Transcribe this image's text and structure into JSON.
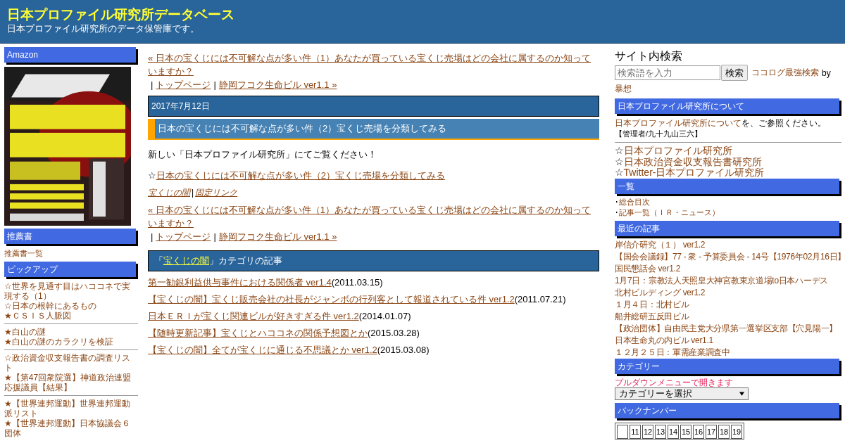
{
  "header": {
    "title": "日本プロファイル研究所データベース",
    "subtitle": "日本プロファイル研究所のデータ保管庫です。"
  },
  "left": {
    "amazon": {
      "heading": "Amazon"
    },
    "books": {
      "heading": "推薦書",
      "link": "推薦書一覧"
    },
    "pickup": {
      "heading": "ピックアップ",
      "groups": [
        [
          "☆世界を見通す目はハココネで実現する（1）",
          "☆日本の根幹にあるもの",
          "★ＣＳＩＳ人脈図"
        ],
        [
          "★白山の謎",
          "★白山の謎のカラクリを検証"
        ],
        [
          "☆政治資金収支報告書の調査リスト",
          "★【第47回衆院選】神道政治連盟応援議員【結果】"
        ],
        [
          "★【世界連邦運動】世界連邦運動派リスト",
          "★【世界連邦運動】日本協議会６団体"
        ]
      ]
    }
  },
  "main": {
    "nav_top": {
      "prev": "« 日本の宝くじには不可解な点が多い件（1）あなたが買っている宝くじ売場はどの会社に属するのか知っていますか？",
      "sep1": "|",
      "top": "トップページ",
      "sep2": "|",
      "next": "静岡フコク生命ビル ver1.1 »"
    },
    "date": "2017年7月12日",
    "post_title": "日本の宝くじには不可解な点が多い件（2）宝くじ売場を分類してみる",
    "body": "新しい「日本プロファイル研究所」にてご覧ください！",
    "body_link": {
      "prefix": "☆",
      "text": "日本の宝くじには不可解な点が多い件（2）宝くじ売場を分類してみる"
    },
    "post_footer": {
      "category": "宝くじの闇",
      "sep": "|",
      "permalink": "固定リンク"
    },
    "nav_bottom": {
      "prev": "« 日本の宝くじには不可解な点が多い件（1）あなたが買っている宝くじ売場はどの会社に属するのか知っていますか？",
      "sep1": "|",
      "top": "トップページ",
      "sep2": "|",
      "next": "静岡フコク生命ビル ver1.1 »"
    },
    "category_heading": {
      "open": "「",
      "category": "宝くじの闇",
      "close": "」カテゴリの記事"
    },
    "articles": [
      {
        "title": "第一勧銀利益供与事件における関係者 ver1.4",
        "date": "(2011.03.15)"
      },
      {
        "title": "【宝くじの闇】宝くじ販売会社の社長がジャンボの行列客として報道されている件 ver1.2",
        "date": "(2011.07.21)"
      },
      {
        "title": "日本ＥＲＩが宝くじ関連ビルが好きすぎる件 ver1.2",
        "date": "(2014.01.07)"
      },
      {
        "title": "【随時更新記事】宝くじとハココネの関係予想図とか",
        "date": "(2015.03.28)"
      },
      {
        "title": "【宝くじの闇】全てが宝くじに通じる不思議とか ver1.2",
        "date": "(2015.03.08)"
      }
    ]
  },
  "right": {
    "search": {
      "heading": "サイト内検索",
      "placeholder": "検索語を入力",
      "button": "検索",
      "credit_link": "ココログ最強検索",
      "credit_by": "by",
      "credit_author": "暴想"
    },
    "about": {
      "heading": "日本プロファイル研究所について",
      "link": "日本プロファイル研究所について",
      "text": "を、ご参照ください。",
      "admin": "【管理者/九十九山三六】",
      "sites": [
        {
          "prefix": "☆",
          "text": "日本プロファイル研究所"
        },
        {
          "prefix": "☆",
          "text": "日本政治資金収支報告書研究所"
        },
        {
          "prefix": "☆",
          "text": "Twitter-日本プロファイル研究所"
        }
      ]
    },
    "index": {
      "heading": "一覧",
      "items": [
        {
          "prefix": "･",
          "text": "総合目次"
        },
        {
          "prefix": "･",
          "text": "記事一覧（ＩＲ・ニュース）"
        }
      ]
    },
    "recent": {
      "heading": "最近の記事",
      "items": [
        "岸信介研究（１） ver1.2",
        "【国会会議録】77 - 衆 - 予算委員会 - 14号【1976年02月16日】",
        "国民懇話会 ver1.2",
        "1月7日：宗教法人天照皇大神宮教東京道場to日本ハーデス",
        "北村ビルディング ver1.2",
        "１月４日：北村ビル",
        "船井総研五反田ビル",
        "【政治団体】自由民主党大分県第一選挙区支部【穴見陽一】",
        "日本生命丸の内ビル ver1.1",
        "１２月２５日：軍需産業調査中"
      ]
    },
    "categories": {
      "heading": "カテゴリー",
      "note": "プルダウンメニューで開きます",
      "select": "カテゴリーを選択"
    },
    "backnumber": {
      "heading": "バックナンバー",
      "cells": [
        {
          "kind": "blank"
        },
        {
          "kind": "day",
          "text": "11"
        },
        {
          "kind": "day",
          "text": "12"
        },
        {
          "kind": "day",
          "text": "13"
        },
        {
          "kind": "day",
          "text": "14"
        },
        {
          "kind": "day",
          "text": "15"
        },
        {
          "kind": "day",
          "text": "16"
        },
        {
          "kind": "day",
          "text": "17"
        },
        {
          "kind": "day",
          "text": "18"
        },
        {
          "kind": "day",
          "text": "19"
        }
      ]
    }
  }
}
